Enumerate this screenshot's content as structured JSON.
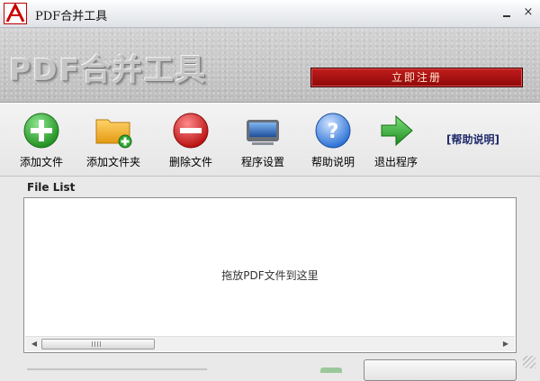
{
  "window": {
    "title": "PDF合并工具",
    "icon": "pdf-app-icon",
    "minimize_glyph": "",
    "close_glyph": "×"
  },
  "banner": {
    "title": "PDF合并工具",
    "register_label": "立即注册"
  },
  "toolbar": {
    "items": [
      {
        "label": "添加文件",
        "icon": "add-file-icon"
      },
      {
        "label": "添加文件夹",
        "icon": "add-folder-icon"
      },
      {
        "label": "删除文件",
        "icon": "delete-file-icon"
      },
      {
        "label": "程序设置",
        "icon": "settings-icon"
      },
      {
        "label": "帮助说明",
        "icon": "help-icon"
      },
      {
        "label": "退出程序",
        "icon": "exit-icon"
      }
    ],
    "help_link": "[帮助说明]"
  },
  "file_list": {
    "label": "File List",
    "placeholder": "拖放PDF文件到这里",
    "scroll_left": "◀",
    "scroll_right": "▶"
  },
  "colors": {
    "register_red": "#a30f0f",
    "help_link": "#1f2a6b",
    "add_green": "#2fa52f",
    "delete_red": "#d42020",
    "help_blue": "#2b6fd6"
  }
}
